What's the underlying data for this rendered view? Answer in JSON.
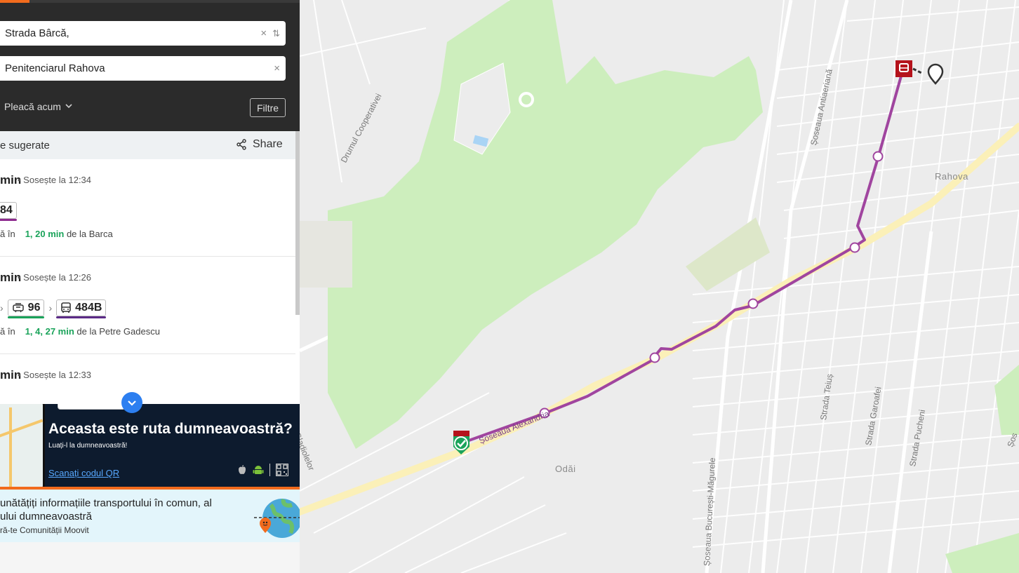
{
  "search": {
    "origin_value": "Strada Bârcă,",
    "destination_value": "Penitenciarul Rahova",
    "depart_label": "Pleacă acum",
    "filters_label": "Filtre"
  },
  "suggested": {
    "title": "e sugerate",
    "share_label": "Share"
  },
  "routes": [
    {
      "duration": "min",
      "arrival": "Sosește la 12:34",
      "legs": [
        {
          "label": "84",
          "color": "#8e2a8f",
          "icon": "bus-icon"
        }
      ],
      "next_prefix": "ă în",
      "next_times": "1, 20 min",
      "next_from": "de la Barca"
    },
    {
      "duration": "min",
      "arrival": "Sosește la 12:26",
      "legs": [
        {
          "label": "96",
          "color": "#1aa35a",
          "icon": "tram-icon"
        },
        {
          "label": "484B",
          "color": "#5b2a86",
          "icon": "bus-icon"
        }
      ],
      "next_prefix": "ă în",
      "next_times": "1, 4, 27 min",
      "next_from": "de la Petre Gadescu"
    },
    {
      "duration": "min",
      "arrival": "Sosește la 12:33",
      "legs": [],
      "next_prefix": "",
      "next_times": "",
      "next_from": ""
    }
  ],
  "promo": {
    "title": "Aceasta este ruta dumneavoastră?",
    "subtitle": "Luați-l la dumneavoastră!",
    "qr_link": "Scanați codul QR"
  },
  "community": {
    "line1": "unătățiți informațiile transportului în comun, al",
    "line2": "ului dumneavoastră",
    "line3": "ră-te Comunității Moovit"
  },
  "map": {
    "labels": {
      "drumul_cooperativei": "Drumul Cooperativei",
      "antiaeriana": "Șoseaua Antiaeriană",
      "rahova": "Rahova",
      "alexandria": "Șoseaua Alexandria",
      "odai": "Odăi",
      "gladiolelor": "Gladiolelor",
      "bucuresti_magurele": "Șoseaua București-Măgurele",
      "teius": "Strada Teiuș",
      "garoafei": "Strada Garoafei",
      "pucheni": "Strada Pucheni",
      "sos_edge": "Șos"
    },
    "colors": {
      "route": "#a0459f",
      "park": "#cdeebd",
      "main_road": "#fbf0b8",
      "stop_marker": "#b5121b",
      "start_check": "#1aa35a"
    }
  }
}
